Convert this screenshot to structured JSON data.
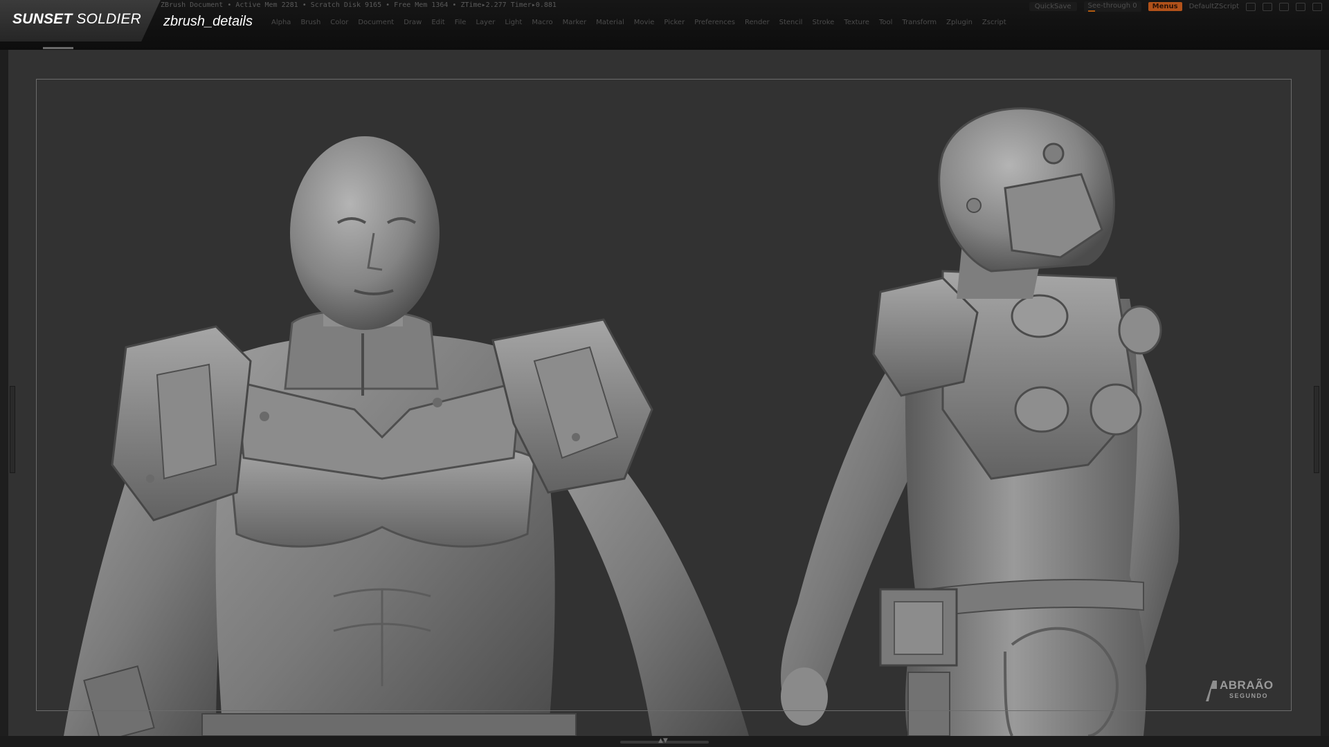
{
  "header": {
    "brand_bold": "SUNSET",
    "brand_light": " SOLDIER",
    "document_title": "zbrush_details",
    "status_text": "ZBrush Document  • Active Mem 2281 • Scratch Disk 9165 • Free Mem 1364 • ZTime▸2.277 Timer▸0.881",
    "menus": [
      "Alpha",
      "Brush",
      "Color",
      "Document",
      "Draw",
      "Edit",
      "File",
      "Layer",
      "Light",
      "Macro",
      "Marker",
      "Material",
      "Movie",
      "Picker",
      "Preferences",
      "Render",
      "Stencil",
      "Stroke",
      "Texture",
      "Tool",
      "Transform",
      "Zplugin",
      "Zscript"
    ],
    "quicksave_label": "QuickSave",
    "see_through_label": "See-through",
    "see_through_value": "0",
    "menus_button_label": "Menus",
    "script_label": "DefaultZScript"
  },
  "viewport": {
    "background_color": "#323232",
    "clay_color": "#8a8a8a",
    "figures": [
      {
        "name": "front-view",
        "description_icon": "female-soldier-front-icon"
      },
      {
        "name": "back-view",
        "description_icon": "female-soldier-back-icon"
      }
    ]
  },
  "watermark": {
    "line1": "ABRAÃO",
    "line2": "SEGUNDO"
  }
}
